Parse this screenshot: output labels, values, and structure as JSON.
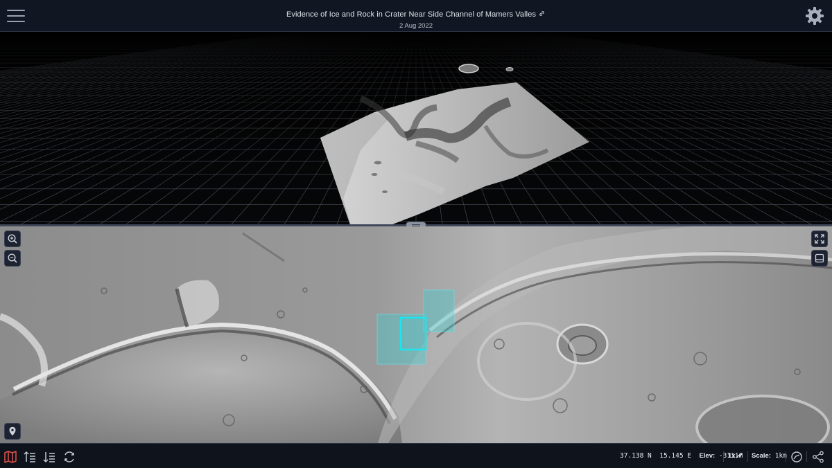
{
  "header": {
    "title": "Evidence of Ice and Rock in Crater Near Side Channel of Mamers Valles",
    "date": "2 Aug 2022",
    "icons": [
      "menu-icon",
      "link-icon",
      "gear-icon"
    ]
  },
  "map": {
    "icons": [
      "zoom-in-icon",
      "zoom-out-icon",
      "fullscreen-icon",
      "layout-icon",
      "location-pin-icon"
    ]
  },
  "footer": {
    "latitude": "37.138 N",
    "longitude": "15.145 E",
    "elevation_label": "Elev:",
    "elevation_value": "-3111m",
    "exaggeration": "1x",
    "scale_label": "Scale:",
    "scale_value": "1km",
    "icons": [
      "map-icon",
      "sort-ascending-icon",
      "sort-descending-icon",
      "refresh-icon",
      "compass-icon",
      "share-icon"
    ]
  },
  "colors": {
    "accent_cyan": "#19e6ee",
    "map_icon_red": "#e0524c",
    "header_bg": "#111722"
  }
}
